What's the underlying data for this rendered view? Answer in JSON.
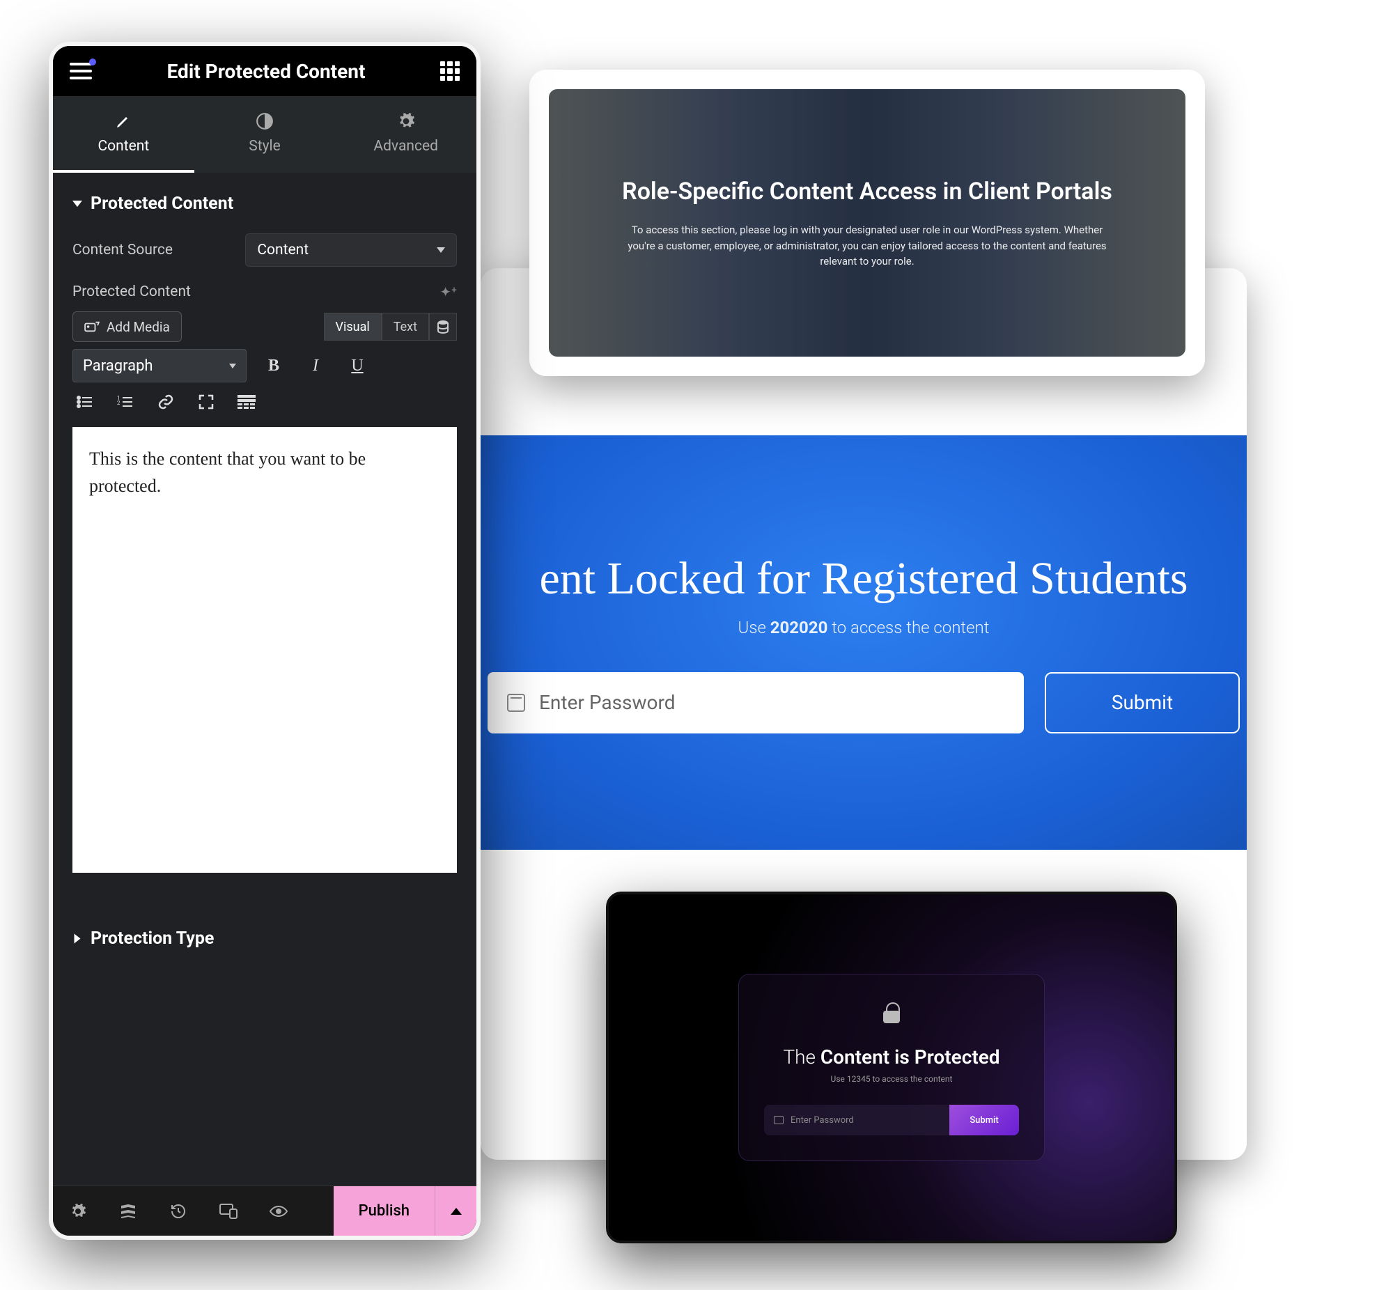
{
  "editor": {
    "title": "Edit Protected Content",
    "tabs": {
      "content": "Content",
      "style": "Style",
      "advanced": "Advanced"
    },
    "sections": {
      "protected_content": "Protected Content",
      "protection_type": "Protection Type"
    },
    "fields": {
      "content_source_label": "Content Source",
      "content_source_value": "Content",
      "protected_content_label": "Protected Content"
    },
    "wysiwyg": {
      "add_media": "Add Media",
      "visual_tab": "Visual",
      "text_tab": "Text",
      "format_select": "Paragraph",
      "content": "This is the content that you want to be protected."
    },
    "footer": {
      "publish": "Publish"
    }
  },
  "preview_top": {
    "title": "Role-Specific Content Access in Client Portals",
    "body": "To access this section, please log in with your designated user role in our WordPress system. Whether you're a customer, employee, or administrator, you can enjoy tailored access to the content and features relevant to your role."
  },
  "preview_mid": {
    "heading_prefix": "ent Locked for Registered Students",
    "sub_pre": "Use ",
    "sub_code": "202020",
    "sub_post": " to access the content",
    "placeholder": "Enter Password",
    "submit": "Submit"
  },
  "preview_bot": {
    "title_pre": "The ",
    "title_mid": "Content is Protected",
    "sub": "Use 12345 to access the content",
    "placeholder": "Enter Password",
    "submit": "Submit"
  }
}
